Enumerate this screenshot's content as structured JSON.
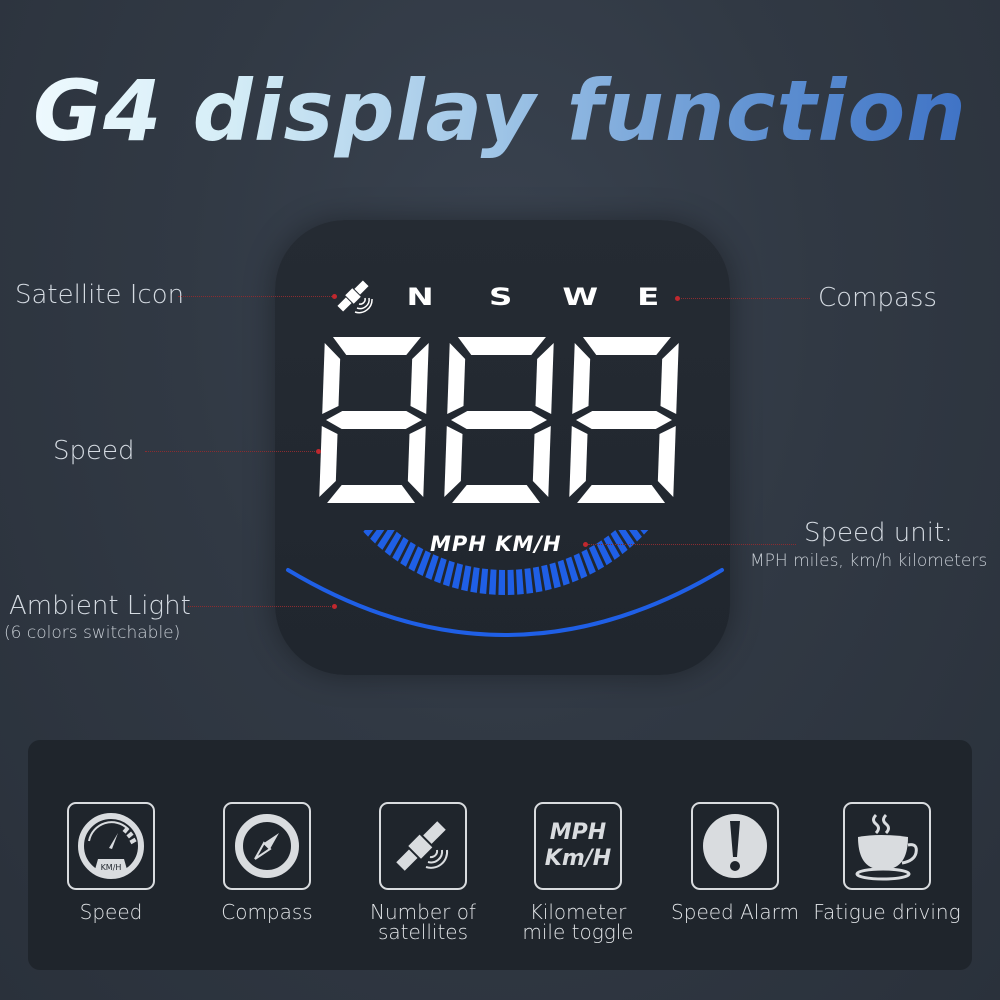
{
  "title": "G4 display function",
  "device": {
    "compass_letters": [
      "N",
      "S",
      "W",
      "E"
    ],
    "speed_digits": "888",
    "units_text": "MPH KM/H",
    "ambient_color": "#1f5fe6"
  },
  "callouts": {
    "satellite": "Satellite Icon",
    "compass": "Compass",
    "speed": "Speed",
    "speed_unit_title": "Speed unit:",
    "speed_unit_desc": "MPH miles, km/h kilometers",
    "ambient_title": "Ambient Light",
    "ambient_desc": "(6 colors switchable)"
  },
  "features": [
    {
      "icon": "speedometer-icon",
      "label_line1": "Speed",
      "label_line2": "",
      "badge": "KM/H"
    },
    {
      "icon": "compass-icon",
      "label_line1": "Compass",
      "label_line2": ""
    },
    {
      "icon": "satellite-icon",
      "label_line1": "Number of",
      "label_line2": "satellites"
    },
    {
      "icon": "unit-toggle-icon",
      "label_line1": "Kilometer",
      "label_line2": "mile toggle",
      "line1": "MPH",
      "line2": "Km/H"
    },
    {
      "icon": "alarm-icon",
      "label_line1": "Speed Alarm",
      "label_line2": ""
    },
    {
      "icon": "coffee-cup-icon",
      "label_line1": "Fatigue driving",
      "label_line2": ""
    }
  ],
  "colors": {
    "accent_blue": "#1f5fe6",
    "leader_red": "#c0282e",
    "icon_gray": "#d9dcdf"
  }
}
